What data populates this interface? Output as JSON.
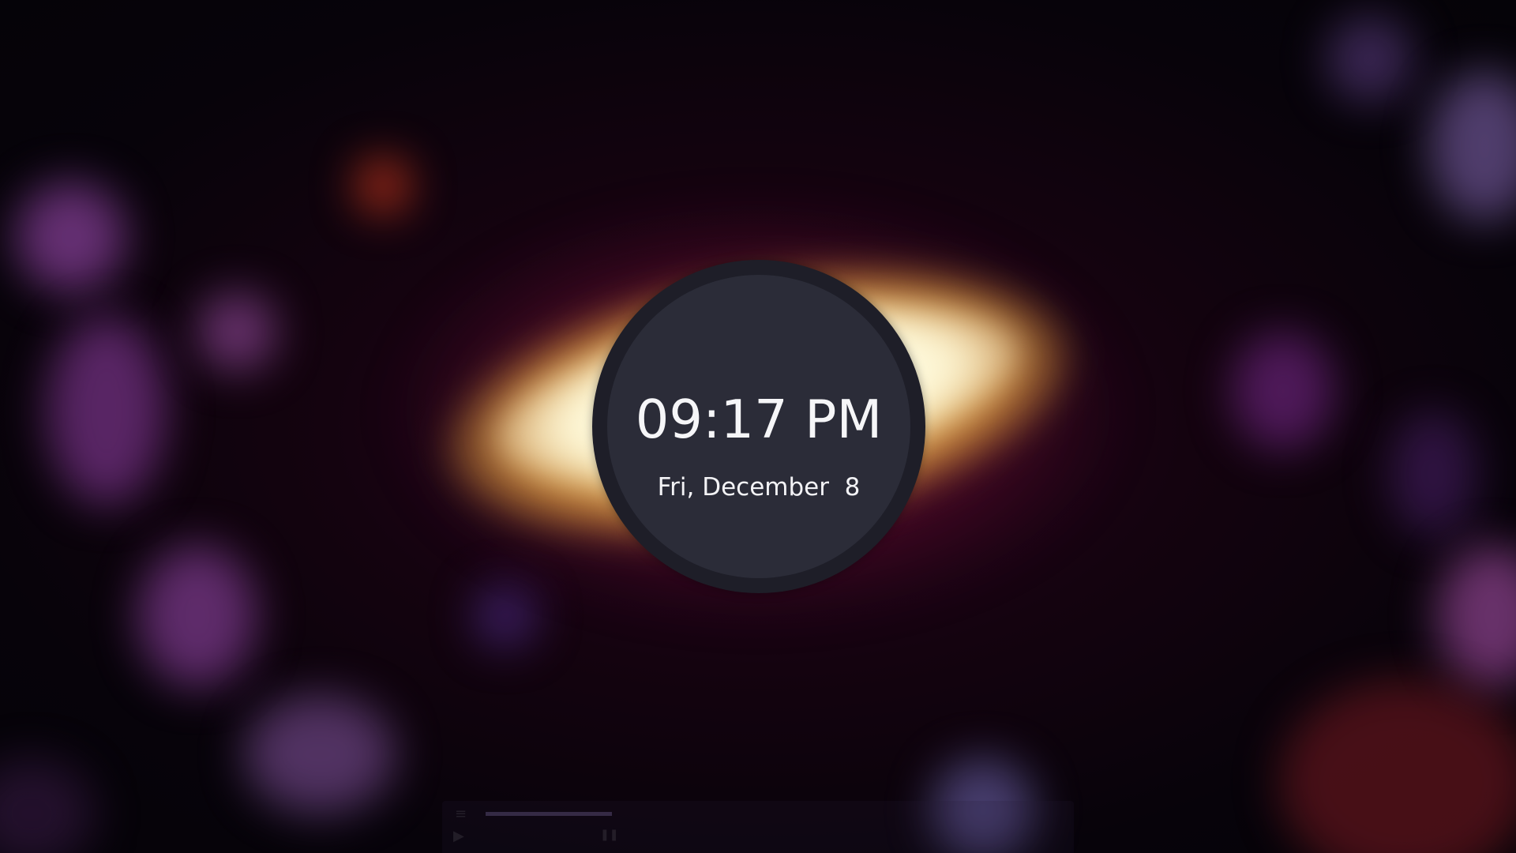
{
  "lockscreen": {
    "time": "09:17 PM",
    "date": "Fri, December  8"
  },
  "colors": {
    "clock_ring": "#1e1e28",
    "clock_face": "#2b2c38",
    "clock_text": "#f6f6f8",
    "halo_glow": "#fff6d0",
    "background": "#07030a"
  },
  "icons": {
    "play": "play-icon",
    "pause": "pause-icon",
    "menu": "menu-icon"
  }
}
